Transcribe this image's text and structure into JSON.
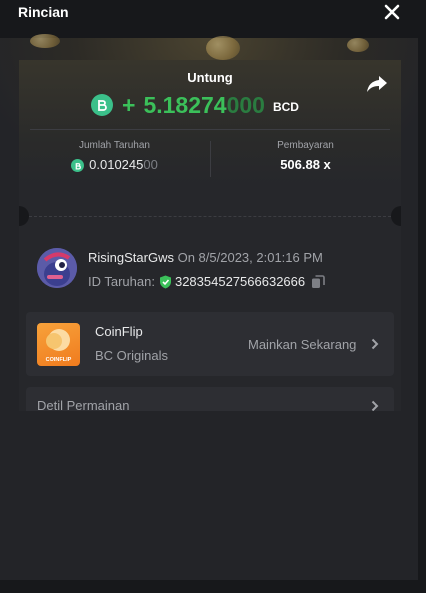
{
  "header": {
    "title": "Rincian"
  },
  "result": {
    "profit_label": "Untung",
    "profit_sign": "+",
    "profit_main": "5.18274",
    "profit_trailing": "000",
    "currency": "BCD",
    "bet_amount_label": "Jumlah Taruhan",
    "bet_amount_main": "0.010245",
    "bet_amount_trailing": "00",
    "payout_label": "Pembayaran",
    "payout_value": "506.88 x"
  },
  "bet": {
    "username": "RisingStarGws",
    "date_text": "On 8/5/2023, 2:01:16 PM",
    "id_label": "ID Taruhan:",
    "id_value": "328354527566632666"
  },
  "game": {
    "name": "CoinFlip",
    "provider": "BC Originals",
    "play_label": "Mainkan Sekarang",
    "thumb_text": "COINFLIP"
  },
  "details": {
    "label": "Detil Permainan"
  },
  "colors": {
    "accent_green": "#3bc05a",
    "bcd_coin": "#3bc08a",
    "background": "#17181b",
    "card": "#26272b"
  },
  "icons": [
    "close-icon",
    "share-icon",
    "bcd-coin-icon",
    "shield-check-icon",
    "copy-icon",
    "chevron-right-icon"
  ]
}
